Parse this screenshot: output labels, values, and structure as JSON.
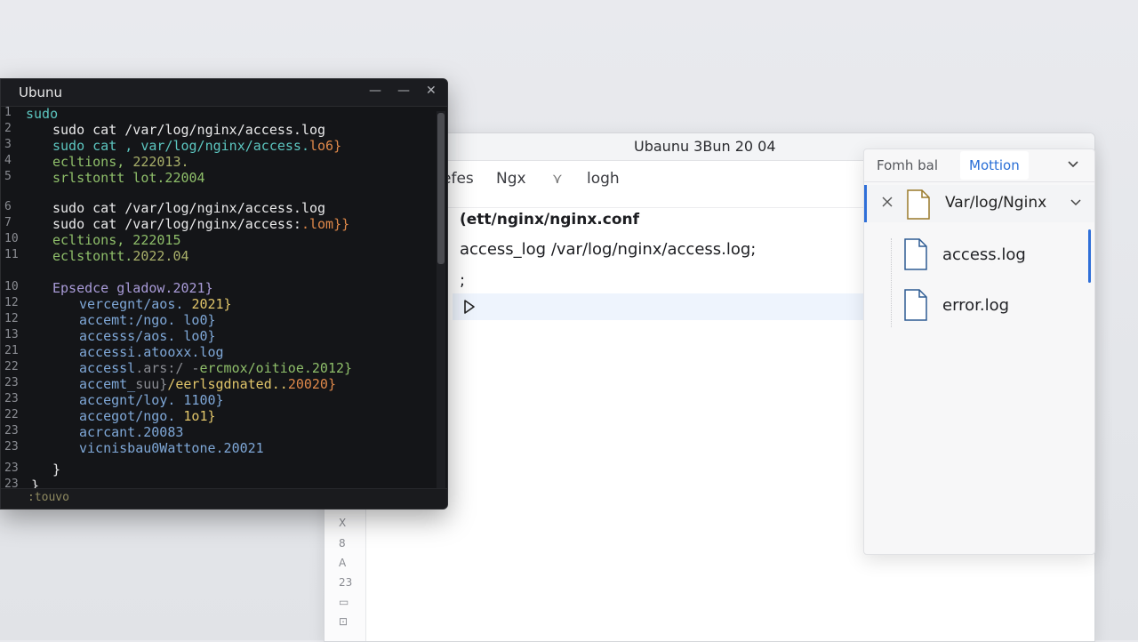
{
  "terminal": {
    "title": "Ubunu",
    "buttons": {
      "minimize": "—",
      "restore": "—",
      "close": "✕"
    },
    "lines": [
      {
        "n": "1",
        "indent": 28,
        "segs": [
          {
            "t": "sudo",
            "c": "teal"
          }
        ]
      },
      {
        "n": "2",
        "indent": 58,
        "segs": [
          {
            "t": "sudo cat /var/log/nginx/access.log",
            "c": "white"
          }
        ]
      },
      {
        "n": "3",
        "indent": 58,
        "segs": [
          {
            "t": "sudo cat , var/log/nginx/access.",
            "c": "teal"
          },
          {
            "t": "lo6}",
            "c": "orange"
          }
        ]
      },
      {
        "n": "4",
        "indent": 58,
        "segs": [
          {
            "t": "ecltions, ",
            "c": "green"
          },
          {
            "t": "222013.",
            "c": "olive"
          }
        ]
      },
      {
        "n": "5",
        "indent": 58,
        "segs": [
          {
            "t": "srlstontt lot.22004",
            "c": "green"
          }
        ]
      },
      {
        "n": "6",
        "indent": 58,
        "segs": [
          {
            "t": "sudo cat /var/log/nginx/access.log",
            "c": "white"
          }
        ]
      },
      {
        "n": "7",
        "indent": 58,
        "segs": [
          {
            "t": "sudo cat /var/log/nginx/access:",
            "c": "white"
          },
          {
            "t": ".lom}}",
            "c": "orange"
          }
        ]
      },
      {
        "n": "10",
        "indent": 58,
        "segs": [
          {
            "t": "ecltions, 222015",
            "c": "green"
          }
        ]
      },
      {
        "n": "11",
        "indent": 58,
        "segs": [
          {
            "t": "eclstontt.",
            "c": "green"
          },
          {
            "t": "2022.04",
            "c": "olive"
          }
        ]
      },
      {
        "n": "10",
        "indent": 58,
        "segs": [
          {
            "t": "Epsedce gladow.2021}",
            "c": "purple"
          }
        ]
      },
      {
        "n": "12",
        "indent": 88,
        "segs": [
          {
            "t": "vercegnt/aos. ",
            "c": "blue"
          },
          {
            "t": "2021}",
            "c": "yellow"
          }
        ]
      },
      {
        "n": "12",
        "indent": 88,
        "segs": [
          {
            "t": "accemt:/ngo. lo0}",
            "c": "blue"
          }
        ]
      },
      {
        "n": "13",
        "indent": 88,
        "segs": [
          {
            "t": "accesss/aos. lo0}",
            "c": "blue"
          }
        ]
      },
      {
        "n": "21",
        "indent": 88,
        "segs": [
          {
            "t": "accessi.atooxx.log",
            "c": "blue"
          }
        ]
      },
      {
        "n": "22",
        "indent": 88,
        "segs": [
          {
            "t": "accessl",
            "c": "blue"
          },
          {
            "t": ".ars:/ -",
            "c": "gray"
          },
          {
            "t": "ercmox/oitioe.2012}",
            "c": "green"
          }
        ]
      },
      {
        "n": "23",
        "indent": 88,
        "segs": [
          {
            "t": "accemt_",
            "c": "blue"
          },
          {
            "t": "suu}",
            "c": "gray"
          },
          {
            "t": "/eerlsgdnated..",
            "c": "yellow"
          },
          {
            "t": "20020}",
            "c": "orange"
          }
        ]
      },
      {
        "n": "23",
        "indent": 88,
        "segs": [
          {
            "t": "accegnt/lo",
            "c": "blue"
          },
          {
            "t": "y. 1100}",
            "c": "blue"
          }
        ]
      },
      {
        "n": "22",
        "indent": 88,
        "segs": [
          {
            "t": "accegot/ngo. ",
            "c": "blue"
          },
          {
            "t": "1o1}",
            "c": "yellow"
          }
        ]
      },
      {
        "n": "23",
        "indent": 88,
        "segs": [
          {
            "t": "acrcant.20083",
            "c": "blue"
          }
        ]
      },
      {
        "n": "23",
        "indent": 88,
        "segs": [
          {
            "t": "vicnisbau0Wattone.20021",
            "c": "blue"
          }
        ]
      },
      {
        "n": "23",
        "indent": 58,
        "segs": [
          {
            "t": "}",
            "c": "white"
          }
        ]
      },
      {
        "n": "23",
        "indent": 34,
        "segs": [
          {
            "t": "}",
            "c": "white"
          }
        ]
      }
    ],
    "status": ":touvo"
  },
  "editor": {
    "title": "Ubaunu 3Bun 20 04",
    "tabs": [
      "efes",
      "Ngx",
      "⋎",
      "logh"
    ],
    "code": [
      {
        "text": "(ett/nginx/nginx.conf",
        "bold": true
      },
      {
        "text": "access_log /var/log/nginx/access.log;",
        "bold": false
      },
      {
        "text": ";",
        "bold": false
      }
    ],
    "gutter_icons": [
      "X",
      "8",
      "A",
      "23",
      "▭",
      "⊡"
    ]
  },
  "explorer": {
    "tab_inactive": "Fomh bal",
    "tab_active": "Mottion",
    "folder": "Var/log/Nginx",
    "files": [
      "access.log",
      "error.log"
    ]
  },
  "colors": {
    "accent": "#2f6fd8",
    "terminal_bg": "#141518"
  }
}
